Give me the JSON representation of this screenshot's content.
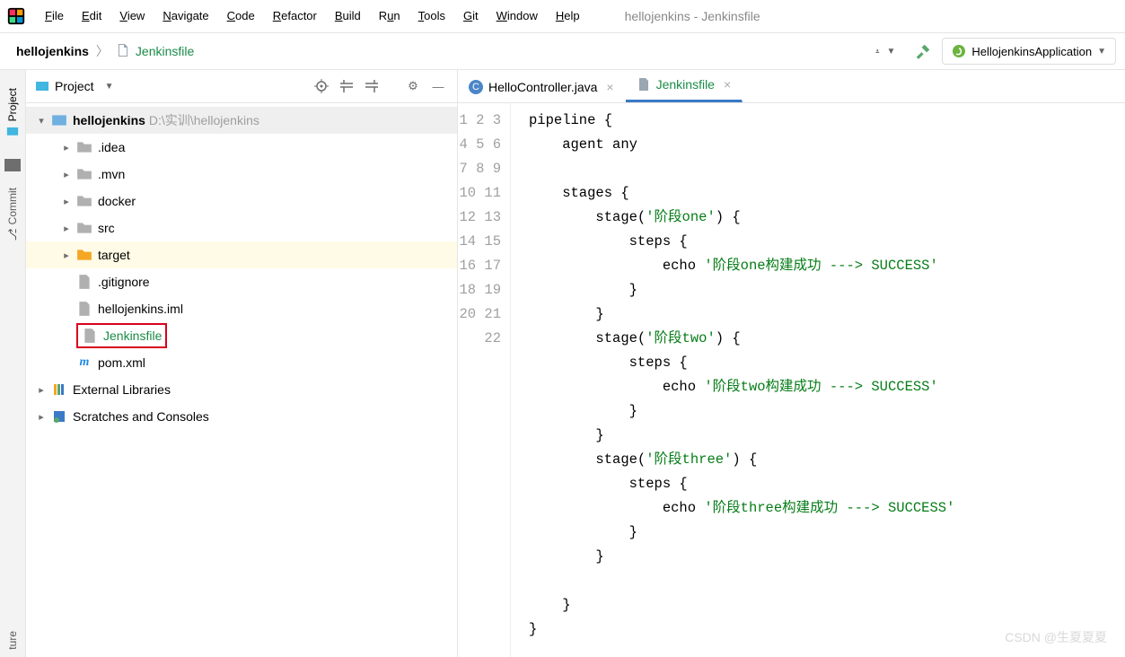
{
  "menu": {
    "file": "File",
    "edit": "Edit",
    "view": "View",
    "navigate": "Navigate",
    "code": "Code",
    "refactor": "Refactor",
    "build": "Build",
    "run": "Run",
    "tools": "Tools",
    "git": "Git",
    "window": "Window",
    "help": "Help"
  },
  "window_title": "hellojenkins - Jenkinsfile",
  "breadcrumb": {
    "root": "hellojenkins",
    "file": "Jenkinsfile"
  },
  "run_config": {
    "name": "HellojenkinsApplication"
  },
  "side": {
    "project": "Project",
    "commit": "Commit",
    "structure": "ture"
  },
  "panel": {
    "title": "Project"
  },
  "tree": {
    "root": {
      "name": "hellojenkins",
      "path": "D:\\实训\\hellojenkins"
    },
    "idea": ".idea",
    "mvn": ".mvn",
    "docker": "docker",
    "src": "src",
    "target": "target",
    "gitignore": ".gitignore",
    "iml": "hellojenkins.iml",
    "jenkinsfile": "Jenkinsfile",
    "pom": "pom.xml",
    "ext": "External Libraries",
    "scratch": "Scratches and Consoles"
  },
  "tabs": {
    "t1": "HelloController.java",
    "t2": "Jenkinsfile"
  },
  "code": {
    "lines": [
      "pipeline {",
      "    agent any",
      "",
      "    stages {",
      "        stage('阶段one') {",
      "            steps {",
      "                echo '阶段one构建成功 ---> SUCCESS'",
      "            }",
      "        }",
      "        stage('阶段two') {",
      "            steps {",
      "                echo '阶段two构建成功 ---> SUCCESS'",
      "            }",
      "        }",
      "        stage('阶段three') {",
      "            steps {",
      "                echo '阶段three构建成功 ---> SUCCESS'",
      "            }",
      "        }",
      "",
      "    }",
      "}"
    ]
  },
  "watermark": "CSDN @生夏夏夏"
}
